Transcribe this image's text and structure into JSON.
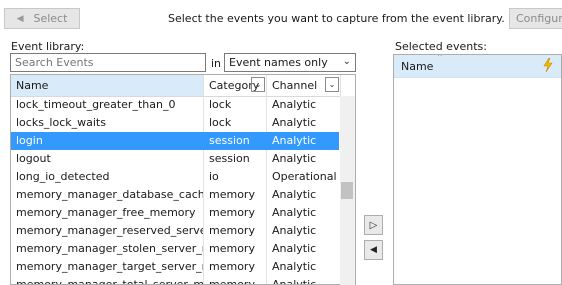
{
  "toolbar": {
    "select_label": "Select",
    "instruction": "Select the events you want to capture from the event library.",
    "configure_label": "Configure"
  },
  "library": {
    "label": "Event library:",
    "search_placeholder": "Search Events",
    "in_label": "in",
    "scope_value": "Event names only",
    "columns": {
      "name": "Name",
      "category": "Category",
      "channel": "Channel"
    },
    "rows": [
      {
        "name": "lock_timeout_greater_than_0",
        "category": "lock",
        "channel": "Analytic",
        "selected": false
      },
      {
        "name": "locks_lock_waits",
        "category": "lock",
        "channel": "Analytic",
        "selected": false
      },
      {
        "name": "login",
        "category": "session",
        "channel": "Analytic",
        "selected": true
      },
      {
        "name": "logout",
        "category": "session",
        "channel": "Analytic",
        "selected": false
      },
      {
        "name": "long_io_detected",
        "category": "io",
        "channel": "Operational",
        "selected": false
      },
      {
        "name": "memory_manager_database_cache_memo...",
        "category": "memory",
        "channel": "Analytic",
        "selected": false
      },
      {
        "name": "memory_manager_free_memory",
        "category": "memory",
        "channel": "Analytic",
        "selected": false
      },
      {
        "name": "memory_manager_reserved_server_memory",
        "category": "memory",
        "channel": "Analytic",
        "selected": false
      },
      {
        "name": "memory_manager_stolen_server_memory",
        "category": "memory",
        "channel": "Analytic",
        "selected": false
      },
      {
        "name": "memory_manager_target_server_memory",
        "category": "memory",
        "channel": "Analytic",
        "selected": false
      },
      {
        "name": "memory_manager_total_server_memory",
        "category": "memory",
        "channel": "Analytic",
        "selected": false
      }
    ]
  },
  "selected_panel": {
    "label": "Selected events:",
    "column_name": "Name",
    "lightning_icon": "lightning-icon"
  },
  "move": {
    "add_icon": "arrow-right-icon",
    "remove_icon": "arrow-left-icon"
  },
  "colors": {
    "selection": "#3399ff",
    "header_highlight": "#d9ebf9"
  }
}
